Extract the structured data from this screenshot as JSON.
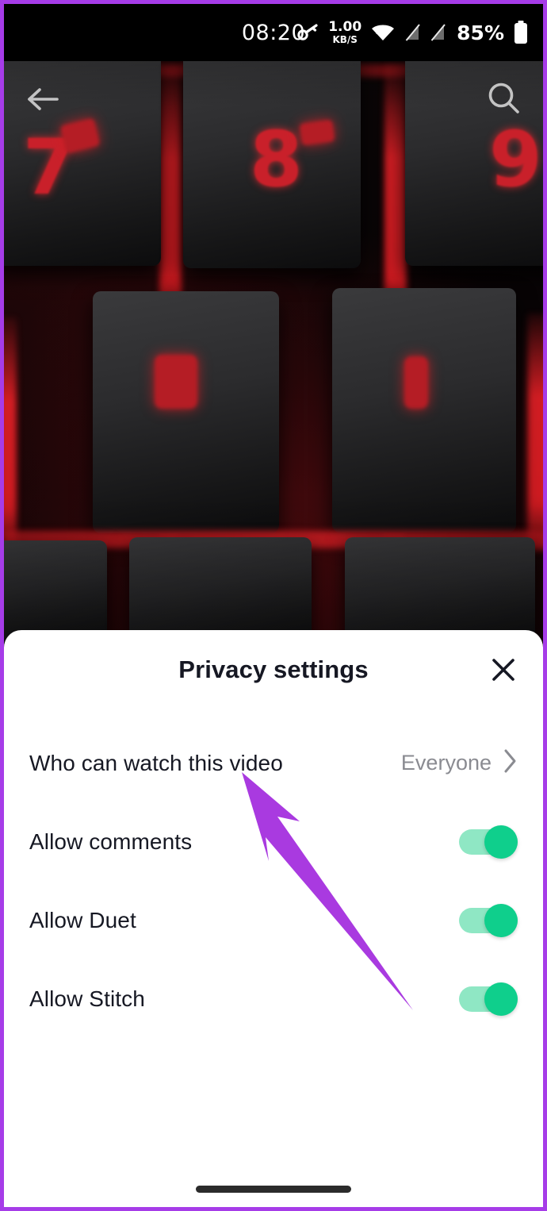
{
  "status_bar": {
    "time": "08:20",
    "net_speed_value": "1.00",
    "net_speed_unit": "KB/S",
    "battery_percent": "85%",
    "icons": [
      "vpn-key-icon",
      "wifi-icon",
      "sim1-no-signal-icon",
      "sim2-no-signal-icon",
      "battery-icon"
    ]
  },
  "video_screen": {
    "back_icon": "back-arrow-icon",
    "search_icon": "search-icon",
    "avatar": "profile-avatar"
  },
  "sheet": {
    "title": "Privacy settings",
    "close_label": "close-icon",
    "rows": [
      {
        "label": "Who can watch this video",
        "type": "select",
        "value": "Everyone",
        "chevron": "chevron-right-icon"
      },
      {
        "label": "Allow comments",
        "type": "toggle",
        "state": "on"
      },
      {
        "label": "Allow Duet",
        "type": "toggle",
        "state": "on"
      },
      {
        "label": "Allow Stitch",
        "type": "toggle",
        "state": "on"
      }
    ]
  },
  "annotation": {
    "type": "arrow",
    "color": "#a93ae0",
    "points_to": "Who can watch this video"
  },
  "colors": {
    "frame_purple": "#a63ce8",
    "toggle_track": "#8fe7c4",
    "toggle_knob": "#0fcf8c",
    "sheet_bg": "#ffffff",
    "text_primary": "#161823",
    "text_secondary": "#8a8b91",
    "keyboard_red": "#c9202a"
  }
}
